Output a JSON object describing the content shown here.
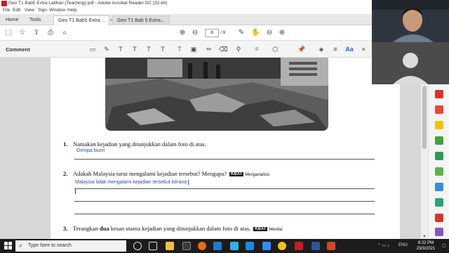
{
  "window": {
    "title": "Geo T1 Bab5 Extra Latihan (Teaching).pdf - Adobe Acrobat Reader DC (32-bit)"
  },
  "menu": [
    "File",
    "Edit",
    "View",
    "Sign",
    "Window",
    "Help"
  ],
  "tabs": [
    {
      "label": "Home"
    },
    {
      "label": "Tools"
    },
    {
      "label": "Geo T1 Bab5 Extra ..."
    },
    {
      "label": "Geo T1 Bab 5 Extra..."
    }
  ],
  "toolbar": {
    "page_current": "8",
    "page_total": "/ 9"
  },
  "comment_toolbar": {
    "label": "Comment"
  },
  "document": {
    "q1": {
      "num": "1.",
      "text": "Namakan kejadian yang ditunjukkan dalam foto di atas.",
      "answer": "Gempa bumi"
    },
    "q2": {
      "num": "2.",
      "text": "Adakah Malaysia turut mengalami kejadian tersebut? Mengapa?",
      "kbat": "KBAT",
      "kbat_sub": "Menganalisis",
      "answer": "Malaysia tidak mengalami kejadian tersebut kerana"
    },
    "q3": {
      "num": "3.",
      "text_pre": "Terangkan ",
      "text_bold": "dua",
      "text_post": " kesan utama kejadian yang ditunjukkan dalam foto di atas.",
      "kbat": "KBAT",
      "kbat_sub": "Menilai"
    }
  },
  "taskbar": {
    "search_placeholder": "Type here to search",
    "language": "ENG",
    "time": "8:22 PM",
    "date": "23/3/2021"
  }
}
